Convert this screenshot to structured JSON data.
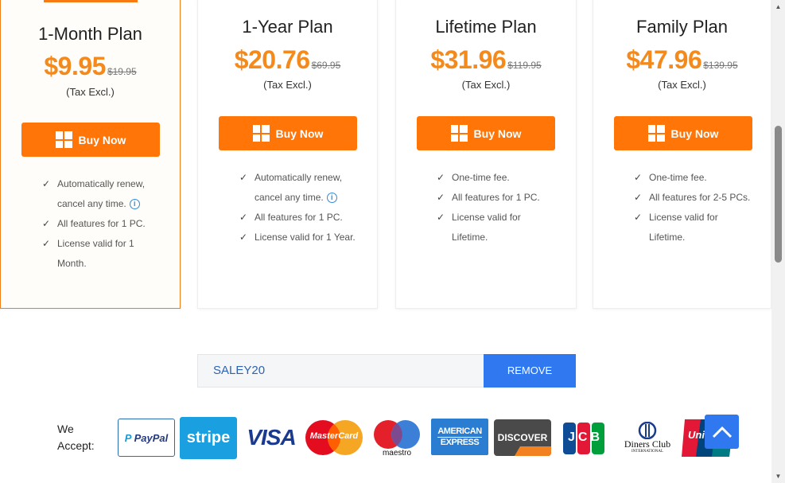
{
  "plans": [
    {
      "name": "1-Month Plan",
      "price": "$9.95",
      "old_price": "$19.95",
      "tax": "(Tax Excl.)",
      "buy_label": "Buy Now",
      "features": [
        "Automatically renew,",
        "cancel any time.",
        "All features for 1 PC.",
        "License valid for 1",
        "Month."
      ]
    },
    {
      "name": "1-Year Plan",
      "price": "$20.76",
      "old_price": "$69.95",
      "tax": "(Tax Excl.)",
      "buy_label": "Buy Now",
      "features": [
        "Automatically renew,",
        "cancel any time.",
        "All features for 1 PC.",
        "License valid for 1 Year."
      ]
    },
    {
      "name": "Lifetime Plan",
      "price": "$31.96",
      "old_price": "$119.95",
      "tax": "(Tax Excl.)",
      "buy_label": "Buy Now",
      "features": [
        "One-time fee.",
        "All features for 1 PC.",
        "License valid for",
        "Lifetime."
      ]
    },
    {
      "name": "Family Plan",
      "price": "$47.96",
      "old_price": "$139.95",
      "tax": "(Tax Excl.)",
      "buy_label": "Buy Now",
      "features": [
        "One-time fee.",
        "All features for 2-5 PCs.",
        "License valid for",
        "Lifetime."
      ]
    }
  ],
  "coupon": {
    "code": "SALEY20",
    "remove_label": "REMOVE"
  },
  "payments": {
    "label_line1": "We",
    "label_line2": "Accept:",
    "paypal": "PayPal",
    "stripe": "stripe",
    "visa": "VISA",
    "mastercard": "MasterCard",
    "maestro": "maestro",
    "amex_line1": "AMERICAN",
    "amex_line2": "EXPRESS",
    "discover": "DISCOVER",
    "jcb": "JCB",
    "diners_line1": "Diners Club",
    "diners_line2": "INTERNATIONAL",
    "unionpay": "Uni"
  },
  "colors": {
    "accent_orange": "#ff7507",
    "price_orange": "#f48a1c",
    "blue": "#2f78f0"
  },
  "icons": {
    "buy": "windows-icon",
    "check": "check-icon",
    "info": "info-icon",
    "back_to_top": "chevron-up-icon"
  }
}
